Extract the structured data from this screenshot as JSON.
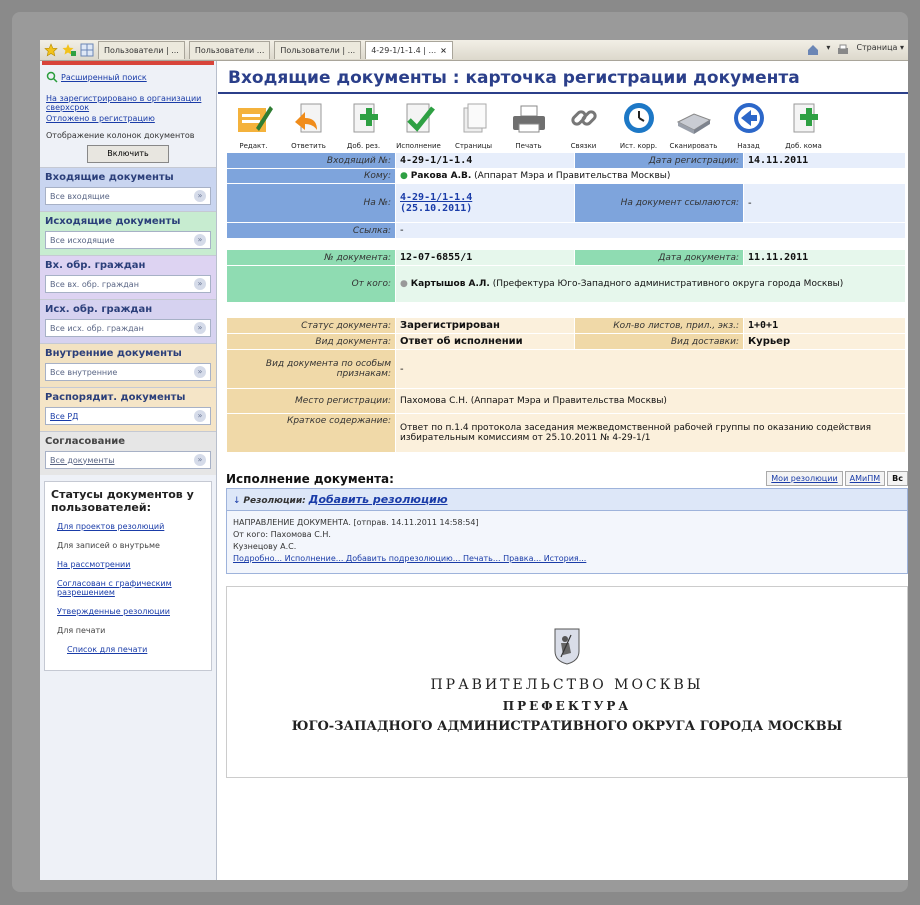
{
  "browser": {
    "tabs": [
      {
        "label": "Пользователи | ..."
      },
      {
        "label": "Пользователи ..."
      },
      {
        "label": "Пользователи | ..."
      },
      {
        "label": "4-29-1/1-1.4 | ...",
        "active": true
      }
    ],
    "right_items": [
      "▾",
      "Страница ▾"
    ]
  },
  "sidebar": {
    "search_link": "Расширенный поиск",
    "links": [
      "На зарегистрировано в организации сверхсрок",
      "Отложено в регистрацию"
    ],
    "view_label": "Отображение колонок документов",
    "enable_button": "Включить",
    "sections": [
      {
        "title": "Входящие документы",
        "select": "Все входящие"
      },
      {
        "title": "Исходящие документы",
        "select": "Все исходящие"
      },
      {
        "title": "Вх. обр. граждан",
        "select": "Все вх. обр. граждан"
      },
      {
        "title": "Исх. обр. граждан",
        "select": "Все исх. обр. граждан"
      },
      {
        "title": "Внутренние документы",
        "select": "Все внутренние"
      },
      {
        "title": "Распорядит. документы",
        "select": "Все РД"
      },
      {
        "title": "Согласование",
        "select": "Все документы"
      }
    ],
    "statuses_title": "Статусы документов у пользователей:",
    "statuses": [
      {
        "label": "Для проектов резолюций",
        "link": true
      },
      {
        "label": "Для записей о внутрьме",
        "link": false
      },
      {
        "label": "На рассмотрении",
        "link": true
      },
      {
        "label": "Согласован с графическим разрешением",
        "link": true
      },
      {
        "label": "Утвержденные резолюции",
        "link": true
      },
      {
        "label": "Для печати",
        "link": false
      },
      {
        "label": "Список для печати",
        "link": true
      }
    ]
  },
  "main": {
    "title": "Входящие документы : карточка регистрации документа",
    "toolbar": [
      {
        "label": "Редакт.",
        "icon": "edit-icon"
      },
      {
        "label": "Ответить",
        "icon": "reply-icon"
      },
      {
        "label": "Доб. рез.",
        "icon": "add-resolution-icon"
      },
      {
        "label": "Исполнение",
        "icon": "execute-icon"
      },
      {
        "label": "Страницы",
        "icon": "pages-icon"
      },
      {
        "label": "Печать",
        "icon": "print-icon"
      },
      {
        "label": "Связки",
        "icon": "link-icon"
      },
      {
        "label": "Ист. корр.",
        "icon": "history-icon"
      },
      {
        "label": "Сканировать",
        "icon": "scanner-icon"
      },
      {
        "label": "Назад",
        "icon": "back-icon"
      },
      {
        "label": "Доб. кома",
        "icon": "add-icon"
      }
    ],
    "card": {
      "in_no_label": "Входящий №:",
      "in_no": "4-29-1/1-1.4",
      "reg_date_label": "Дата регистрации:",
      "reg_date": "14.11.2011",
      "to_label": "Кому:",
      "to_name": "Ракова А.В.",
      "to_org": "(Аппарат Мэра и Правительства Москвы)",
      "on_no_label": "На №:",
      "on_no": "4-29-1/1-1.4",
      "on_no_date": "(25.10.2011)",
      "doc_link_label": "На документ ссылаются:",
      "doc_link": "-",
      "ref_label": "Ссылка:",
      "ref": "-",
      "doc_no_label": "№ документа:",
      "doc_no": "12-07-6855/1",
      "doc_date_label": "Дата документа:",
      "doc_date": "11.11.2011",
      "from_label": "От кого:",
      "from_name": "Картышов А.Л.",
      "from_org": "(Префектура Юго-Западного административного округа города Москвы)",
      "status_label": "Статус документа:",
      "status": "Зарегистрирован",
      "sheets_label": "Кол-во листов, прил., экз.:",
      "sheets": "1+0+1",
      "type_label": "Вид документа:",
      "type": "Ответ об исполнении",
      "delivery_label": "Вид доставки:",
      "delivery": "Курьер",
      "special_label": "Вид документа по особым признакам:",
      "special": "-",
      "place_label": "Место регистрации:",
      "place": "Пахомова С.Н. (Аппарат Мэра и Правительства Москвы)",
      "summary_label": "Краткое содержание:",
      "summary": "Ответ по п.1.4 протокола заседания межведомственной рабочей группы по оказанию содействия избирательным комиссиям от 25.10.2011 № 4-29-1/1"
    },
    "execution": {
      "title": "Исполнение документа:",
      "tabs": [
        "Мои резолюции",
        "АМиПМ",
        "Вс"
      ],
      "resolutions_label": "Резолюции:",
      "add_link": "Добавить резолюцию",
      "line1": "НАПРАВЛЕНИЕ ДОКУМЕНТА. [отправ. 14.11.2011 14:58:54]",
      "line2": "От кого: Пахомова С.Н.",
      "line3": "Кузнецову А.С.",
      "links": "Подробно... Исполнение... Добавить подрезолюцию... Печать... Правка... История..."
    },
    "document": {
      "line1": "ПРАВИТЕЛЬСТВО МОСКВЫ",
      "line2": "ПРЕФЕКТУРА",
      "line3": "ЮГО-ЗАПАДНОГО АДМИНИСТРАТИВНОГО ОКРУГА ГОРОДА МОСКВЫ"
    }
  }
}
